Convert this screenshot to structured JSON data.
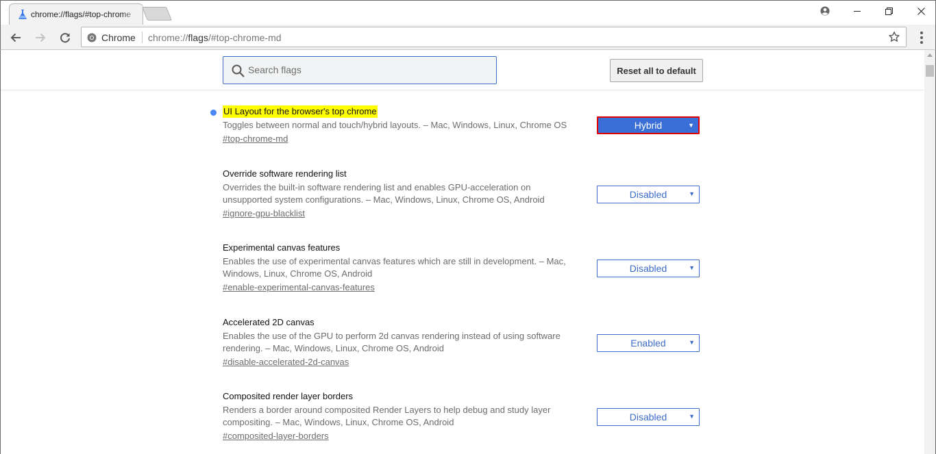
{
  "tab": {
    "title": "chrome://flags/#top-chrome-md"
  },
  "omnibox": {
    "site_chip": "Chrome",
    "url_scheme": "chrome://",
    "url_host": "flags",
    "url_path": "/#top-chrome-md"
  },
  "search": {
    "placeholder": "Search flags",
    "value": ""
  },
  "reset_button": "Reset all to default",
  "colors": {
    "accent": "#3c6cc8",
    "highlight": "#ffff00",
    "active_outline": "#e20000",
    "unsaved_dot": "#4a85f5"
  },
  "flags": [
    {
      "title": "UI Layout for the browser's top chrome",
      "description": "Toggles between normal and touch/hybrid layouts. – Mac, Windows, Linux, Chrome OS",
      "link": "#top-chrome-md",
      "value": "Hybrid",
      "highlighted": true
    },
    {
      "title": "Override software rendering list",
      "description": "Overrides the built-in software rendering list and enables GPU-acceleration on unsupported system configurations. – Mac, Windows, Linux, Chrome OS, Android",
      "link": "#ignore-gpu-blacklist",
      "value": "Disabled"
    },
    {
      "title": "Experimental canvas features",
      "description": "Enables the use of experimental canvas features which are still in development. – Mac, Windows, Linux, Chrome OS, Android",
      "link": "#enable-experimental-canvas-features",
      "value": "Disabled"
    },
    {
      "title": "Accelerated 2D canvas",
      "description": "Enables the use of the GPU to perform 2d canvas rendering instead of using software rendering. – Mac, Windows, Linux, Chrome OS, Android",
      "link": "#disable-accelerated-2d-canvas",
      "value": "Enabled"
    },
    {
      "title": "Composited render layer borders",
      "description": "Renders a border around composited Render Layers to help debug and study layer compositing. – Mac, Windows, Linux, Chrome OS, Android",
      "link": "#composited-layer-borders",
      "value": "Disabled"
    }
  ]
}
